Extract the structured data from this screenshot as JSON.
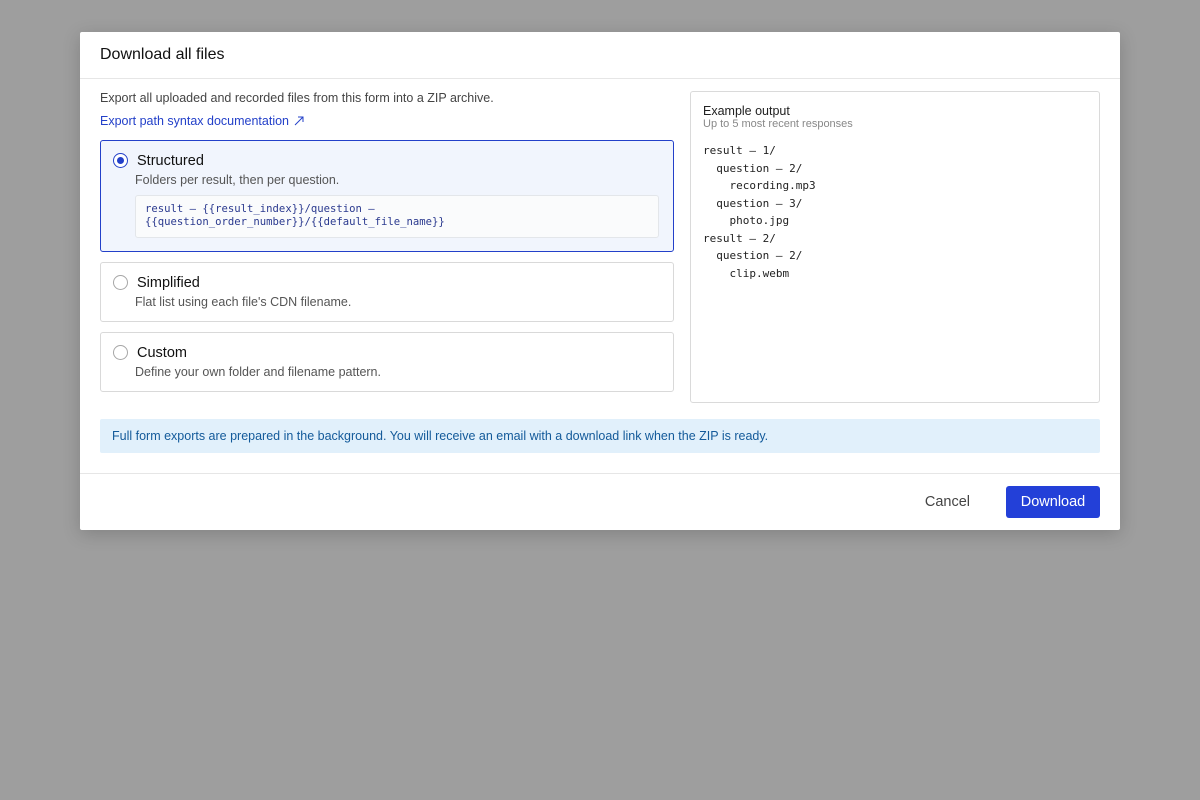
{
  "dialog": {
    "title": "Download all files",
    "description": "Export all uploaded and recorded files from this form into a ZIP archive.",
    "doc_link_label": "Export path syntax documentation",
    "doc_link_icon": "external-link-icon"
  },
  "options": [
    {
      "label": "Structured",
      "description": "Folders per result, then per question.",
      "selected": true,
      "pattern": "result – {{result_index}}/question –\n{{question_order_number}}/{{default_file_name}}"
    },
    {
      "label": "Simplified",
      "description": "Flat list using each file's CDN filename.",
      "selected": false
    },
    {
      "label": "Custom",
      "description": "Define your own folder and filename pattern.",
      "selected": false
    }
  ],
  "example": {
    "title": "Example output",
    "subtitle": "Up to 5 most recent responses",
    "tree": [
      "result – 1/",
      "  question – 2/",
      "    recording.mp3",
      "  question – 3/",
      "    photo.jpg",
      "result – 2/",
      "  question – 2/",
      "    clip.webm"
    ]
  },
  "info_banner": "Full form exports are prepared in the background. You will receive an email with a download link when the ZIP is ready.",
  "footer": {
    "cancel_label": "Cancel",
    "download_label": "Download"
  },
  "colors": {
    "accent": "#2340d8",
    "selected_bg": "#f1f5fd",
    "banner_bg": "#e1f0fb",
    "banner_text": "#135a9a",
    "overlay": "#9e9e9e"
  }
}
